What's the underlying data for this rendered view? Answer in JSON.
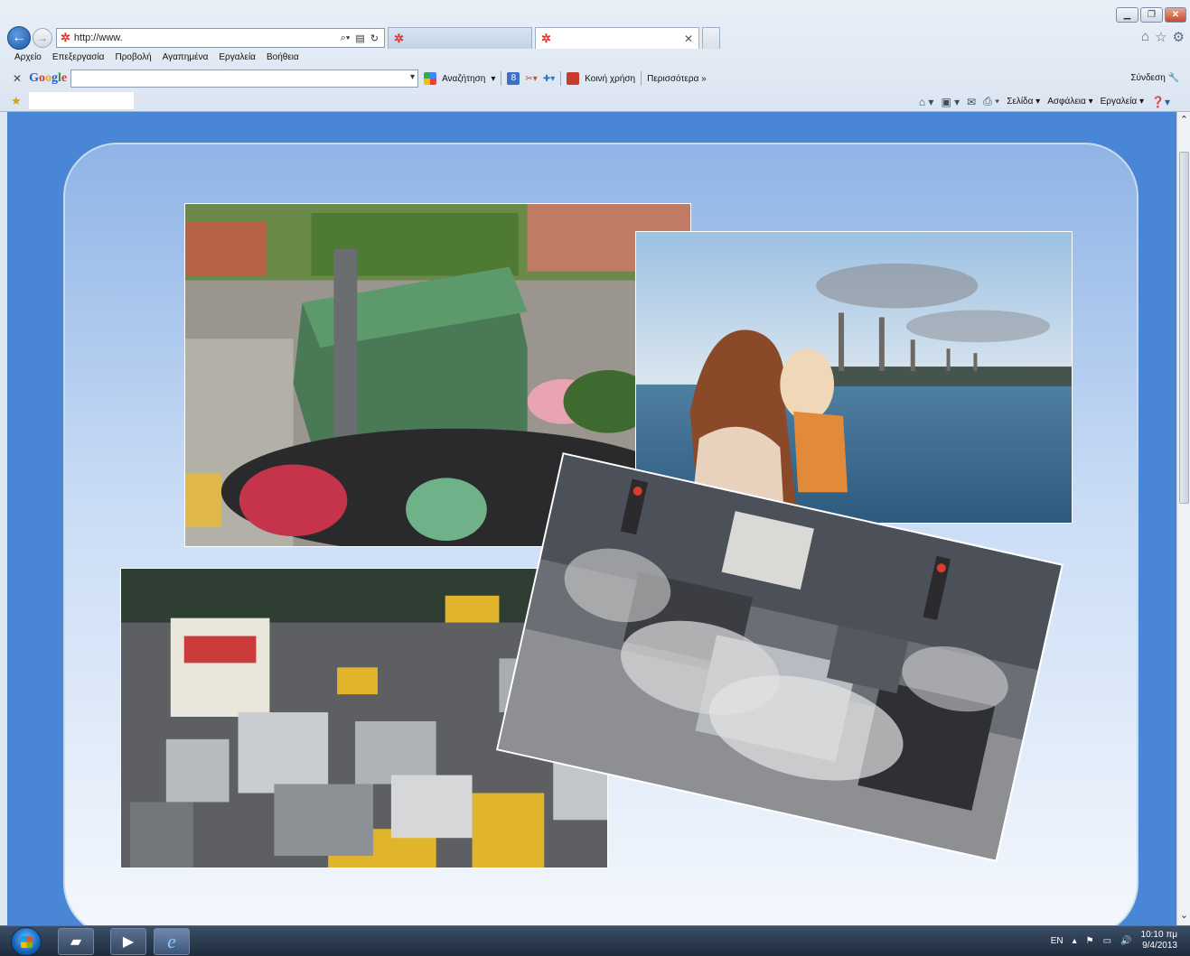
{
  "browser": {
    "address": "http://www.",
    "tabs": [
      {
        "label": ""
      },
      {
        "label": ""
      }
    ],
    "menu": [
      "Αρχείο",
      "Επεξεργασία",
      "Προβολή",
      "Αγαπημένα",
      "Εργαλεία",
      "Βοήθεια"
    ],
    "google_toolbar": {
      "logo": "Google",
      "search_label": "Αναζήτηση",
      "share_label": "Κοινή χρήση",
      "more_label": "Περισσότερα »",
      "signin_label": "Σύνδεση"
    },
    "command_bar": {
      "page_label": "Σελίδα",
      "safety_label": "Ασφάλεια",
      "tools_label": "Εργαλεία"
    }
  },
  "taskbar": {
    "language": "EN",
    "time": "10:10 πμ",
    "date": "9/4/2013"
  },
  "colors": {
    "page_background": "#4a86d6",
    "slide_top": "#8fb4e6",
    "slide_bottom": "#f5f8fd"
  },
  "photos": [
    {
      "name": "overflowing-garbage-bin"
    },
    {
      "name": "mother-child-power-plant"
    },
    {
      "name": "traffic-jam"
    },
    {
      "name": "car-exhaust-smog"
    }
  ]
}
